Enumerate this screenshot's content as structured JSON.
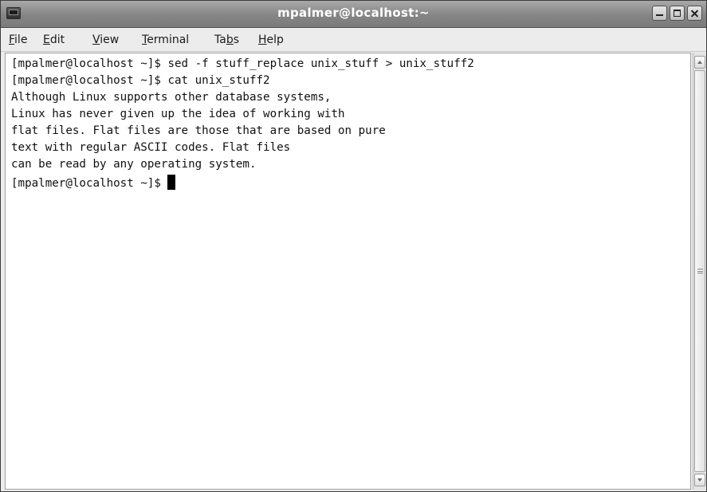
{
  "window": {
    "title": "mpalmer@localhost:~"
  },
  "menubar": {
    "file": {
      "mnemonic": "F",
      "rest": "ile"
    },
    "edit": {
      "mnemonic": "E",
      "rest": "dit"
    },
    "view": {
      "mnemonic": "V",
      "rest": "iew"
    },
    "terminal": {
      "mnemonic": "T",
      "rest": "erminal"
    },
    "tabs": {
      "before": "Ta",
      "mnemonic": "b",
      "rest": "s"
    },
    "help": {
      "mnemonic": "H",
      "rest": "elp"
    }
  },
  "terminal": {
    "lines": [
      "[mpalmer@localhost ~]$ sed -f stuff_replace unix_stuff > unix_stuff2",
      "[mpalmer@localhost ~]$ cat unix_stuff2",
      "Although Linux supports other database systems,",
      "Linux has never given up the idea of working with",
      "flat files. Flat files are those that are based on pure",
      "text with regular ASCII codes. Flat files",
      "can be read by any operating system."
    ],
    "prompt": "[mpalmer@localhost ~]$ ",
    "cursor_style": "block",
    "background_color": "#ffffff",
    "text_color": "#111111"
  },
  "icons": {
    "app": "terminal-icon",
    "minimize": "minimize-icon",
    "maximize": "maximize-icon",
    "close": "close-icon",
    "scroll_up": "arrow-up-icon",
    "scroll_down": "arrow-down-icon"
  }
}
